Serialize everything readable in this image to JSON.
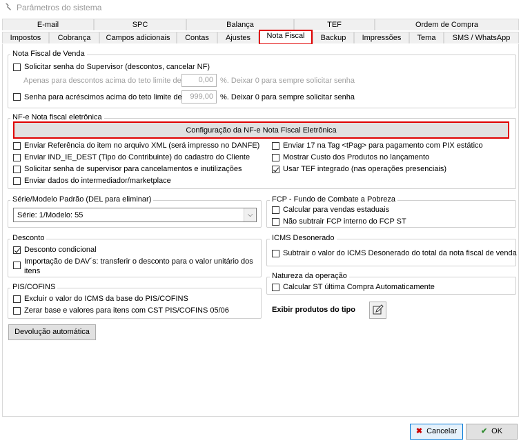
{
  "window": {
    "title": "Parâmetros do sistema"
  },
  "tabs_row1": [
    "E-mail",
    "SPC",
    "Balança",
    "TEF",
    "Ordem de Compra"
  ],
  "tabs_row2": [
    "Impostos",
    "Cobrança",
    "Campos adicionais",
    "Contas",
    "Ajustes",
    "Nota Fiscal",
    "Backup",
    "Impressões",
    "Tema",
    "SMS / WhatsApp"
  ],
  "active_tab": "Nota Fiscal",
  "nota_fiscal_venda": {
    "legend": "Nota Fiscal de Venda",
    "solicitar_senha": "Solicitar senha do Supervisor (descontos, cancelar NF)",
    "apenas_descontos": "Apenas para descontos acima do teto limite de:",
    "descontos_value": "0,00",
    "descontos_hint": "%. Deixar 0 para sempre solicitar senha",
    "senha_acrescimos": "Senha para acréscimos acima do teto limite de:",
    "acrescimos_value": "999,00",
    "acrescimos_hint": "%. Deixar 0 para sempre solicitar senha"
  },
  "nfe": {
    "legend": "NF-e Nota fiscal eletrônica",
    "config_button": "Configuração da NF-e Nota Fiscal Eletrônica",
    "left": [
      {
        "label": "Enviar Referência do item no arquivo XML (será impresso no DANFE)",
        "checked": false
      },
      {
        "label": "Enviar IND_IE_DEST (Tipo do Contribuinte) do cadastro do Cliente",
        "checked": false
      },
      {
        "label": "Solicitar senha de supervisor para cancelamentos e inutilizações",
        "checked": false
      },
      {
        "label": "Enviar dados do intermediador/marketplace",
        "checked": false
      }
    ],
    "right": [
      {
        "label": "Enviar 17 na Tag <tPag> para pagamento com PIX estático",
        "checked": false
      },
      {
        "label": "Mostrar Custo dos Produtos no lançamento",
        "checked": false
      },
      {
        "label": "Usar TEF integrado (nas operações presenciais)",
        "checked": true
      }
    ]
  },
  "serie": {
    "legend": "Série/Modelo Padrão (DEL para eliminar)",
    "value": "Série: 1/Modelo: 55"
  },
  "fcp": {
    "legend": "FCP - Fundo de Combate a Pobreza",
    "calcular": "Calcular para vendas estaduais",
    "nao_subtrair": "Não subtrair FCP interno do FCP ST"
  },
  "desconto": {
    "legend": "Desconto",
    "condicional": "Desconto condicional",
    "condicional_checked": true,
    "importacao_line1": "Importação de DAV´s: transferir o desconto para o valor unitário dos",
    "importacao_line2": "itens"
  },
  "icms": {
    "legend": "ICMS Desonerado",
    "subtrair": "Subtrair o valor do ICMS Desonerado do total da nota fiscal de venda"
  },
  "pis": {
    "legend": "PIS/COFINS",
    "excluir": "Excluir o valor do ICMS da base do PIS/COFINS",
    "zerar": "Zerar base e valores para itens com CST PIS/COFINS 05/06"
  },
  "natureza": {
    "legend": "Natureza da operação",
    "calcular_st": "Calcular ST última Compra Automaticamente"
  },
  "exibir_produtos": "Exibir produtos do tipo",
  "devolucao_button": "Devolução automática",
  "footer": {
    "cancel": "Cancelar",
    "ok": "OK"
  },
  "colors": {
    "highlight": "#e00000",
    "accent_blue": "#0078d7",
    "ok_check": "#2e8b2e",
    "cancel_x": "#cc0000"
  }
}
